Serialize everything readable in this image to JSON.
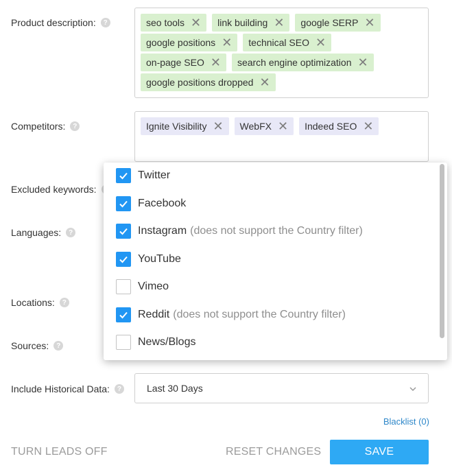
{
  "fields": {
    "product_description": {
      "label": "Product description:",
      "tags": [
        "seo tools",
        "link building",
        "google SERP",
        "google positions",
        "technical SEO",
        "on-page SEO",
        "search engine optimization",
        "google positions dropped"
      ]
    },
    "competitors": {
      "label": "Competitors:",
      "tags": [
        "Ignite Visibility",
        "WebFX",
        "Indeed SEO"
      ]
    },
    "excluded_keywords": {
      "label": "Excluded keywords:"
    },
    "languages": {
      "label": "Languages:"
    },
    "locations": {
      "label": "Locations:"
    },
    "sources": {
      "label": "Sources:"
    },
    "historical": {
      "label": "Include Historical Data:",
      "value": "Last 30 Days"
    }
  },
  "help_glyph": "?",
  "tag_remove_glyph": "✕",
  "sources_dropdown": {
    "options": [
      {
        "label": "Twitter",
        "note": "",
        "checked": true
      },
      {
        "label": "Facebook",
        "note": "",
        "checked": true
      },
      {
        "label": "Instagram",
        "note": "(does not support the Country filter)",
        "checked": true
      },
      {
        "label": "YouTube",
        "note": "",
        "checked": true
      },
      {
        "label": "Vimeo",
        "note": "",
        "checked": false
      },
      {
        "label": "Reddit",
        "note": "(does not support the Country filter)",
        "checked": true
      },
      {
        "label": "News/Blogs",
        "note": "",
        "checked": false
      }
    ]
  },
  "footer": {
    "blacklist_link": "Blacklist (0)",
    "turn_leads_off": "TURN LEADS OFF",
    "reset_changes": "RESET CHANGES",
    "save": "SAVE"
  },
  "colors": {
    "accent": "#2ea9f4",
    "checkbox_on": "#2196f3",
    "tag_green": "#d9f0cf",
    "tag_purple": "#e8e8f7",
    "link": "#2e87c9"
  }
}
